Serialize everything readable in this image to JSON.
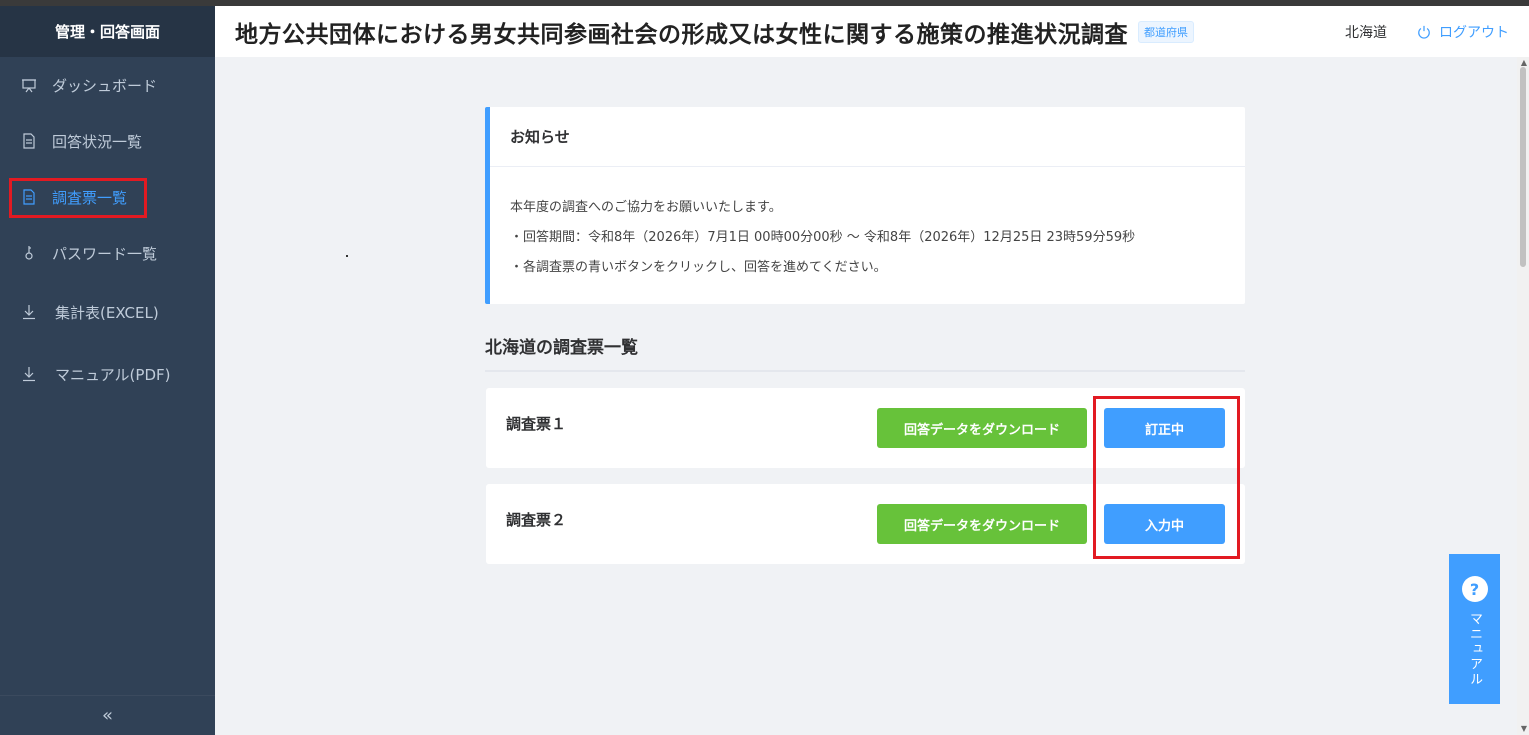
{
  "sidebar": {
    "header": "管理・回答画面",
    "items": [
      {
        "label": "ダッシュボード",
        "icon": "presentation-icon"
      },
      {
        "label": "回答状況一覧",
        "icon": "document-icon"
      },
      {
        "label": "調査票一覧",
        "icon": "document-icon",
        "active": true
      },
      {
        "label": "パスワード一覧",
        "icon": "key-icon"
      },
      {
        "label": "集計表(EXCEL)",
        "icon": "download-icon"
      },
      {
        "label": "マニュアル(PDF)",
        "icon": "download-icon"
      }
    ],
    "collapse": "«"
  },
  "header": {
    "title": "地方公共団体における男女共同参画社会の形成又は女性に関する施策の推進状況調査",
    "tag": "都道府県",
    "prefecture": "北海道",
    "logout": "ログアウト"
  },
  "notice": {
    "title": "お知らせ",
    "lines": [
      "本年度の調査へのご協力をお願いいたします。",
      "・回答期間：令和8年（2026年）7月1日 00時00分00秒 ～ 令和8年（2026年）12月25日 23時59分59秒",
      "・各調査票の青いボタンをクリックし、回答を進めてください。"
    ]
  },
  "forms": {
    "section_title": "北海道の調査票一覧",
    "items": [
      {
        "name": "調査票１",
        "download_label": "回答データをダウンロード",
        "status_label": "訂正中"
      },
      {
        "name": "調査票２",
        "download_label": "回答データをダウンロード",
        "status_label": "入力中"
      }
    ]
  },
  "manual_float": {
    "icon": "?",
    "label": "マニュアル"
  },
  "colors": {
    "sidebar": "#304156",
    "accent": "#409eff",
    "green": "#67c23a",
    "highlight": "#e21a22"
  }
}
